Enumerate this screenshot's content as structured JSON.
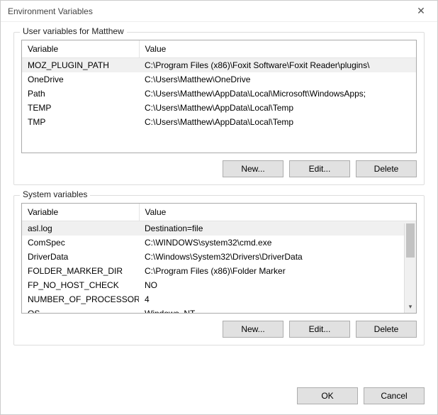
{
  "window": {
    "title": "Environment Variables"
  },
  "userSection": {
    "label": "User variables for Matthew",
    "headers": {
      "variable": "Variable",
      "value": "Value"
    },
    "rows": [
      {
        "name": "MOZ_PLUGIN_PATH",
        "value": "C:\\Program Files (x86)\\Foxit Software\\Foxit Reader\\plugins\\",
        "selected": true
      },
      {
        "name": "OneDrive",
        "value": "C:\\Users\\Matthew\\OneDrive",
        "selected": false
      },
      {
        "name": "Path",
        "value": "C:\\Users\\Matthew\\AppData\\Local\\Microsoft\\WindowsApps;",
        "selected": false
      },
      {
        "name": "TEMP",
        "value": "C:\\Users\\Matthew\\AppData\\Local\\Temp",
        "selected": false
      },
      {
        "name": "TMP",
        "value": "C:\\Users\\Matthew\\AppData\\Local\\Temp",
        "selected": false
      }
    ],
    "buttons": {
      "new": "New...",
      "edit": "Edit...",
      "delete": "Delete"
    }
  },
  "systemSection": {
    "label": "System variables",
    "headers": {
      "variable": "Variable",
      "value": "Value"
    },
    "rows": [
      {
        "name": "asl.log",
        "value": "Destination=file",
        "selected": true
      },
      {
        "name": "ComSpec",
        "value": "C:\\WINDOWS\\system32\\cmd.exe",
        "selected": false
      },
      {
        "name": "DriverData",
        "value": "C:\\Windows\\System32\\Drivers\\DriverData",
        "selected": false
      },
      {
        "name": "FOLDER_MARKER_DIR",
        "value": "C:\\Program Files (x86)\\Folder Marker",
        "selected": false
      },
      {
        "name": "FP_NO_HOST_CHECK",
        "value": "NO",
        "selected": false
      },
      {
        "name": "NUMBER_OF_PROCESSORS",
        "value": "4",
        "selected": false
      },
      {
        "name": "OS",
        "value": "Windows_NT",
        "selected": false
      }
    ],
    "buttons": {
      "new": "New...",
      "edit": "Edit...",
      "delete": "Delete"
    }
  },
  "footer": {
    "ok": "OK",
    "cancel": "Cancel"
  }
}
